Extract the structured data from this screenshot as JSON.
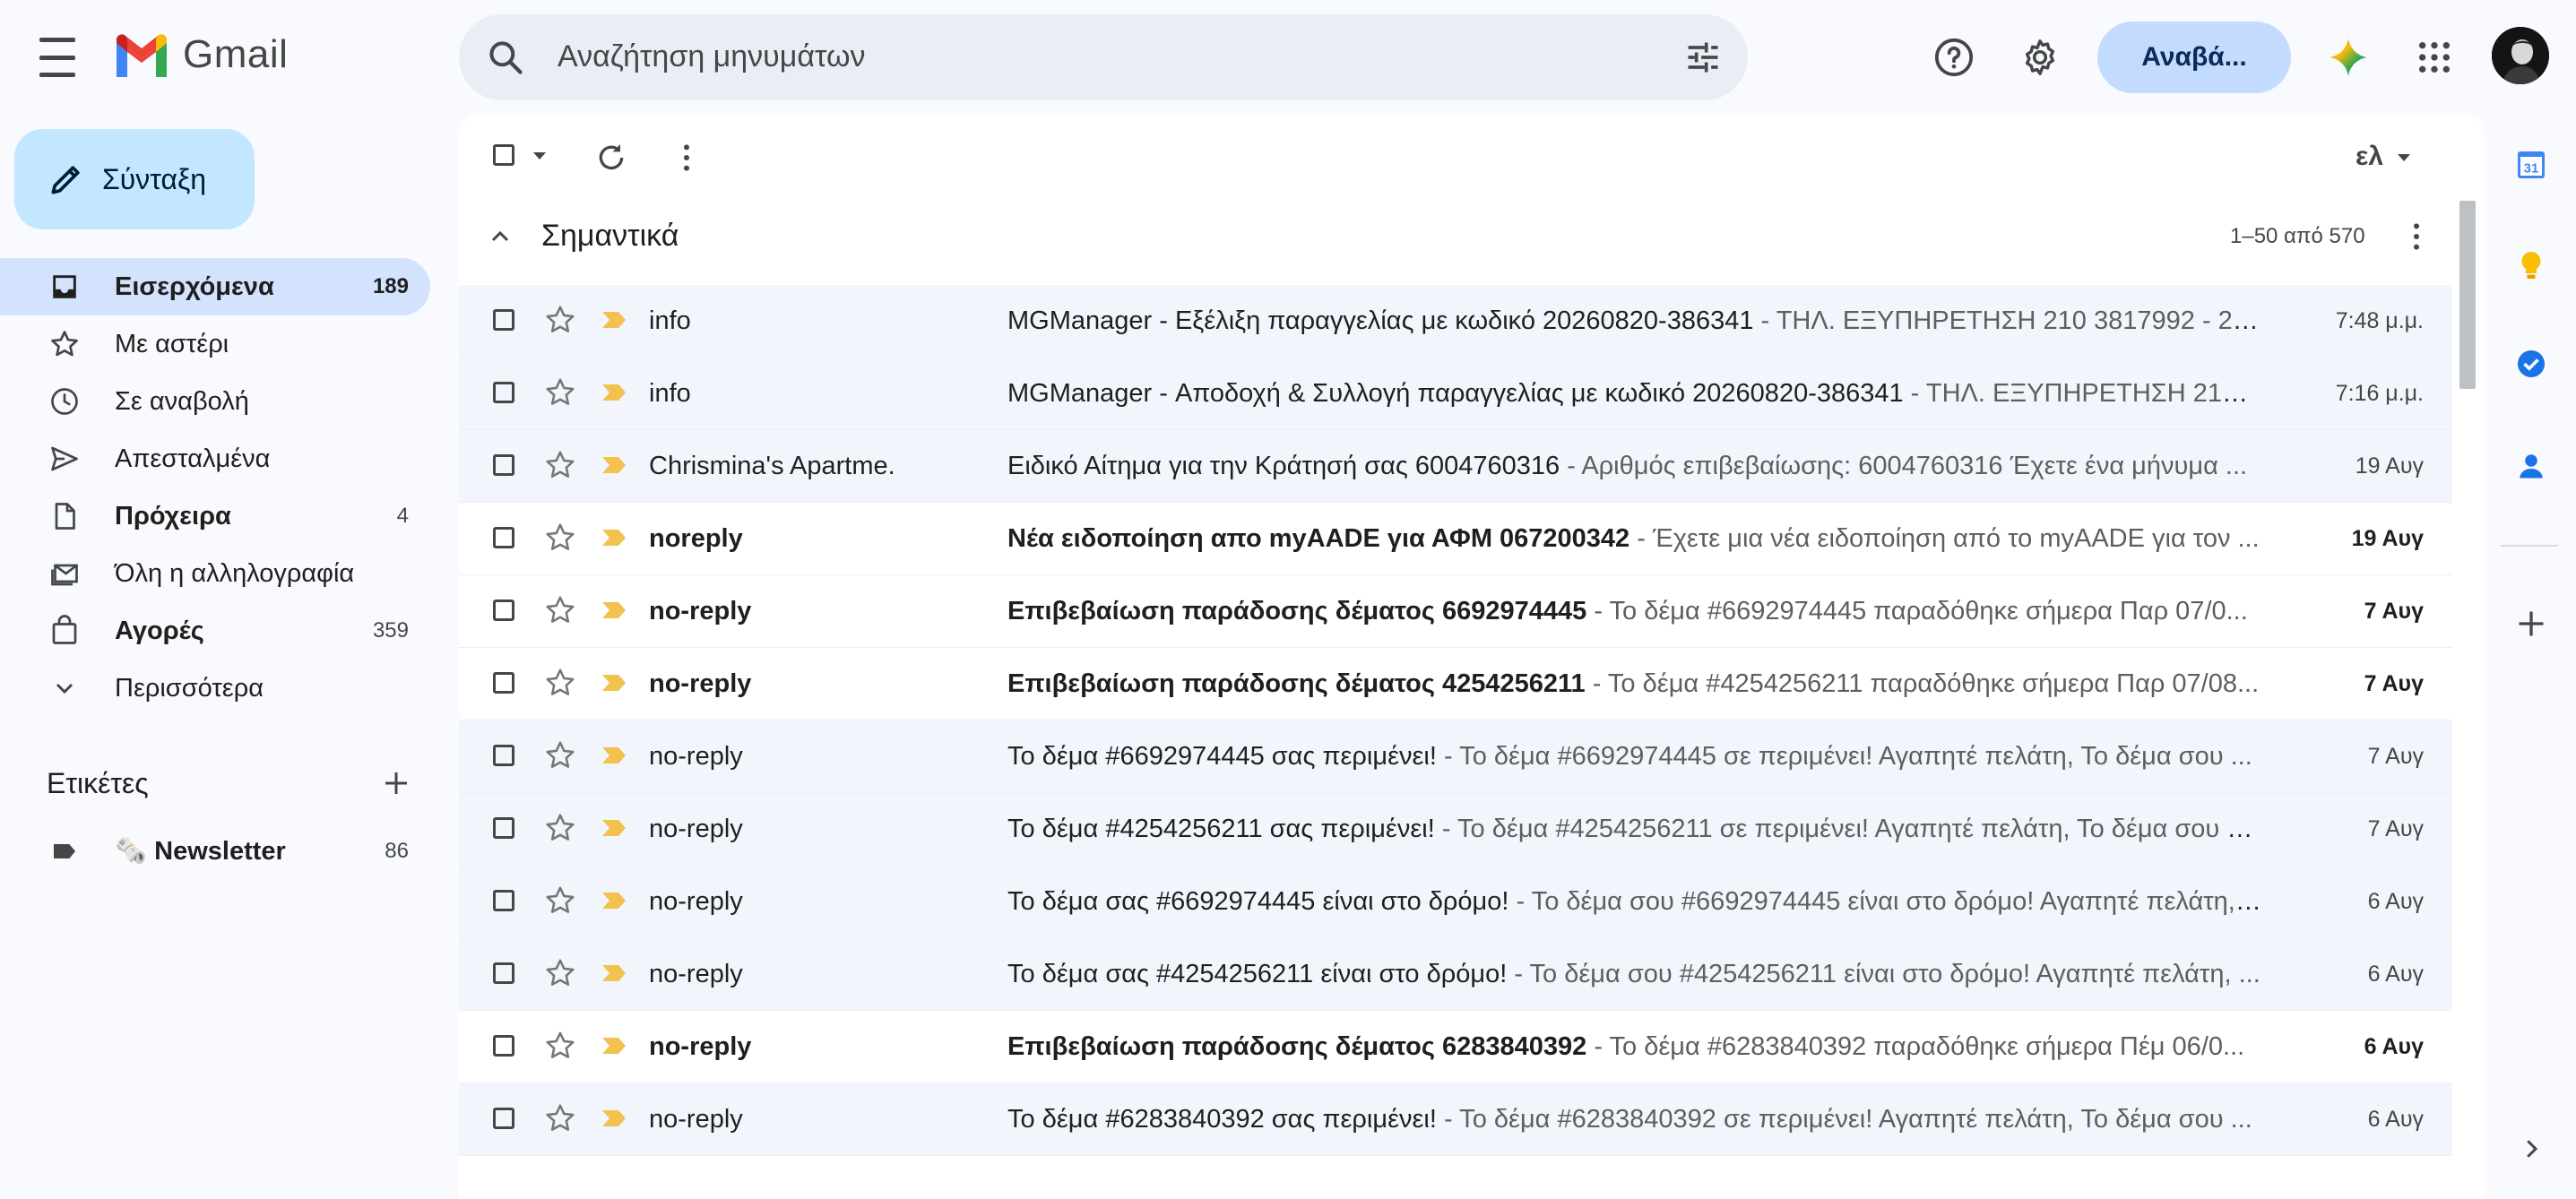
{
  "app": {
    "name": "Gmail"
  },
  "search": {
    "placeholder": "Αναζήτηση μηνυμάτων"
  },
  "header": {
    "upgrade_label": "Αναβά..."
  },
  "compose": {
    "label": "Σύνταξη"
  },
  "sidebar": {
    "items": [
      {
        "label": "Εισερχόμενα",
        "count": "189",
        "icon": "inbox-icon"
      },
      {
        "label": "Με αστέρι",
        "count": "",
        "icon": "star-icon"
      },
      {
        "label": "Σε αναβολή",
        "count": "",
        "icon": "clock-icon"
      },
      {
        "label": "Απεσταλμένα",
        "count": "",
        "icon": "send-icon"
      },
      {
        "label": "Πρόχειρα",
        "count": "4",
        "icon": "draft-icon"
      },
      {
        "label": "Όλη η αλληλογραφία",
        "count": "",
        "icon": "all-mail-icon"
      },
      {
        "label": "Αγορές",
        "count": "359",
        "icon": "shopping-icon"
      },
      {
        "label": "Περισσότερα",
        "count": "",
        "icon": "chevron-down-icon"
      }
    ],
    "labels_title": "Ετικέτες",
    "labels": [
      {
        "label": "🗞️ Newsletter",
        "count": "86"
      }
    ]
  },
  "toolbar": {
    "lang": "ελ"
  },
  "section": {
    "title": "Σημαντικά",
    "range": "1–50 από 570"
  },
  "emails": [
    {
      "sender": "info",
      "subject": "MGManager - Εξέλιξη παραγγελίας με κωδικό 20260820-386341",
      "snippet": " - ΤΗΛ. ΕΞΥΠΗΡΕΤΗΣΗ 210 3817992 - 210 3...",
      "date": "7:48 μ.μ.",
      "unread": false
    },
    {
      "sender": "info",
      "subject": "MGManager - Αποδοχή & Συλλογή παραγγελίας με κωδικό 20260820-386341",
      "snippet": " - ΤΗΛ. ΕΞΥΠΗΡΕΤΗΣΗ 210 38...",
      "date": "7:16 μ.μ.",
      "unread": false
    },
    {
      "sender": "Chrismina's Apartme.",
      "subject": "Ειδικό Αίτημα για την Κράτησή σας 6004760316",
      "snippet": " - Αριθμός επιβεβαίωσης: 6004760316 Έχετε ένα μήνυμα ...",
      "date": "19 Αυγ",
      "unread": false
    },
    {
      "sender": "noreply",
      "subject": "Νέα ειδοποίηση απο myAADE για ΑΦΜ 067200342",
      "snippet": " - Έχετε μια νέα ειδοποίηση από το myAADE για τον ...",
      "date": "19 Αυγ",
      "unread": true
    },
    {
      "sender": "no-reply",
      "subject": "Επιβεβαίωση παράδοσης δέματος 6692974445",
      "snippet": " - Το δέμα #6692974445 παραδόθηκε σήμερα Παρ 07/0...",
      "date": "7 Αυγ",
      "unread": true
    },
    {
      "sender": "no-reply",
      "subject": "Επιβεβαίωση παράδοσης δέματος 4254256211",
      "snippet": " - Το δέμα #4254256211 παραδόθηκε σήμερα Παρ 07/08...",
      "date": "7 Αυγ",
      "unread": true
    },
    {
      "sender": "no-reply",
      "subject": "Το δέμα #6692974445 σας περιμένει!",
      "snippet": " - Το δέμα #6692974445 σε περιμένει! Αγαπητέ πελάτη, Το δέμα σου ...",
      "date": "7 Αυγ",
      "unread": false
    },
    {
      "sender": "no-reply",
      "subject": "Το δέμα #4254256211 σας περιμένει!",
      "snippet": " - Το δέμα #4254256211 σε περιμένει! Αγαπητέ πελάτη, Το δέμα σου μ...",
      "date": "7 Αυγ",
      "unread": false
    },
    {
      "sender": "no-reply",
      "subject": "Το δέμα σας #6692974445 είναι στο δρόμο!",
      "snippet": " - Το δέμα σου #6692974445 είναι στο δρόμο! Αγαπητέ πελάτη, ...",
      "date": "6 Αυγ",
      "unread": false
    },
    {
      "sender": "no-reply",
      "subject": "Το δέμα σας #4254256211 είναι στο δρόμο!",
      "snippet": " - Το δέμα σου #4254256211 είναι στο δρόμο! Αγαπητέ πελάτη, ...",
      "date": "6 Αυγ",
      "unread": false
    },
    {
      "sender": "no-reply",
      "subject": "Επιβεβαίωση παράδοσης δέματος 6283840392",
      "snippet": " - Το δέμα #6283840392 παραδόθηκε σήμερα Πέμ 06/0...",
      "date": "6 Αυγ",
      "unread": true
    },
    {
      "sender": "no-reply",
      "subject": "Το δέμα #6283840392 σας περιμένει!",
      "snippet": " - Το δέμα #6283840392 σε περιμένει! Αγαπητέ πελάτη, Το δέμα σου ...",
      "date": "6 Αυγ",
      "unread": false
    }
  ],
  "right_panel": {
    "calendar_day": "31"
  },
  "colors": {
    "accent": "#0b57d0",
    "importance": "#f2c14e",
    "active_nav": "#d3e3fd",
    "compose_bg": "#c2e7ff"
  }
}
